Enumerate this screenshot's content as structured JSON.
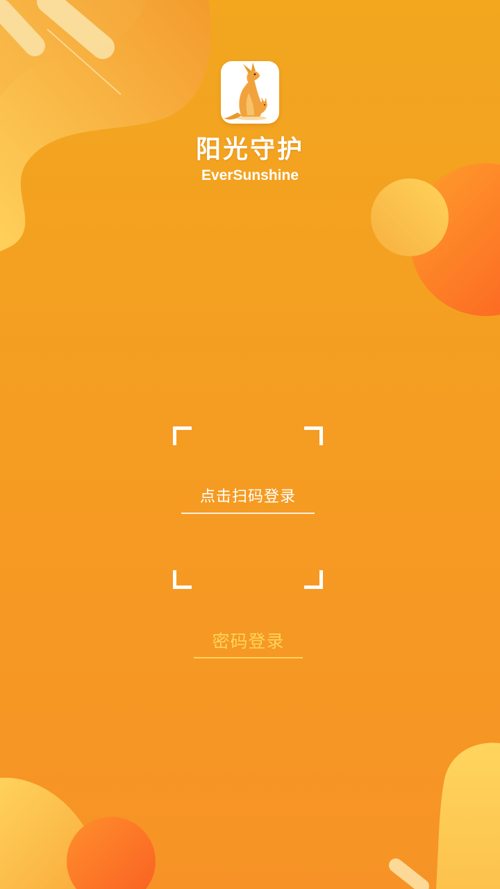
{
  "brand": {
    "name_cn": "阳光守护",
    "name_en": "EverSunshine",
    "logo_icon": "kangaroo-icon"
  },
  "scan": {
    "frame_icon": "qr-scan-frame-icon",
    "login_label": "点击扫码登录"
  },
  "password": {
    "login_label": "密码登录"
  },
  "colors": {
    "background_top": "#f2a71f",
    "background_bottom": "#f79326",
    "accent_yellow": "#ffd45c",
    "text_white": "#ffffff"
  }
}
